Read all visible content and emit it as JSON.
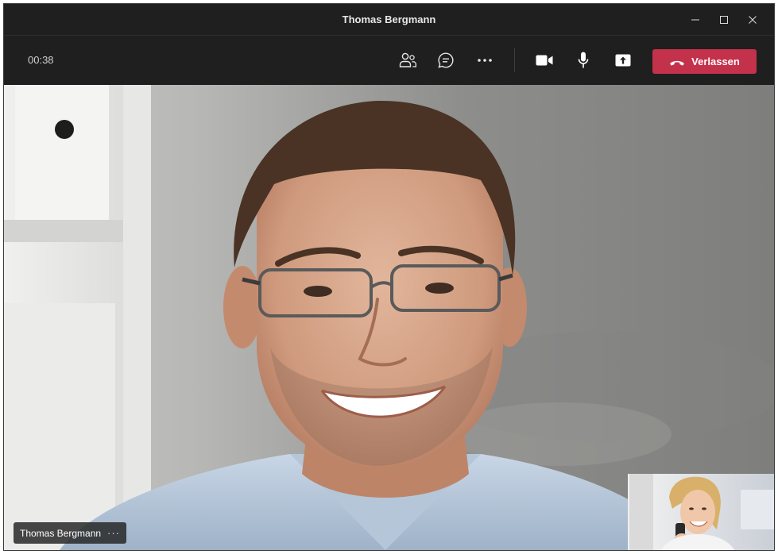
{
  "window": {
    "title": "Thomas Bergmann"
  },
  "toolbar": {
    "timer": "00:38",
    "leave_label": "Verlassen",
    "icons": {
      "people": "people-icon",
      "chat": "chat-icon",
      "more": "more-options-icon",
      "video": "video-camera-icon",
      "mic": "microphone-icon",
      "share": "share-screen-icon",
      "hangup": "hang-up-icon"
    }
  },
  "call": {
    "participant_name": "Thomas Bergmann",
    "more_label": "···"
  },
  "colors": {
    "chrome_bg": "#1f1f1f",
    "leave_button": "#c4314b",
    "icon": "#e6e6e6"
  }
}
